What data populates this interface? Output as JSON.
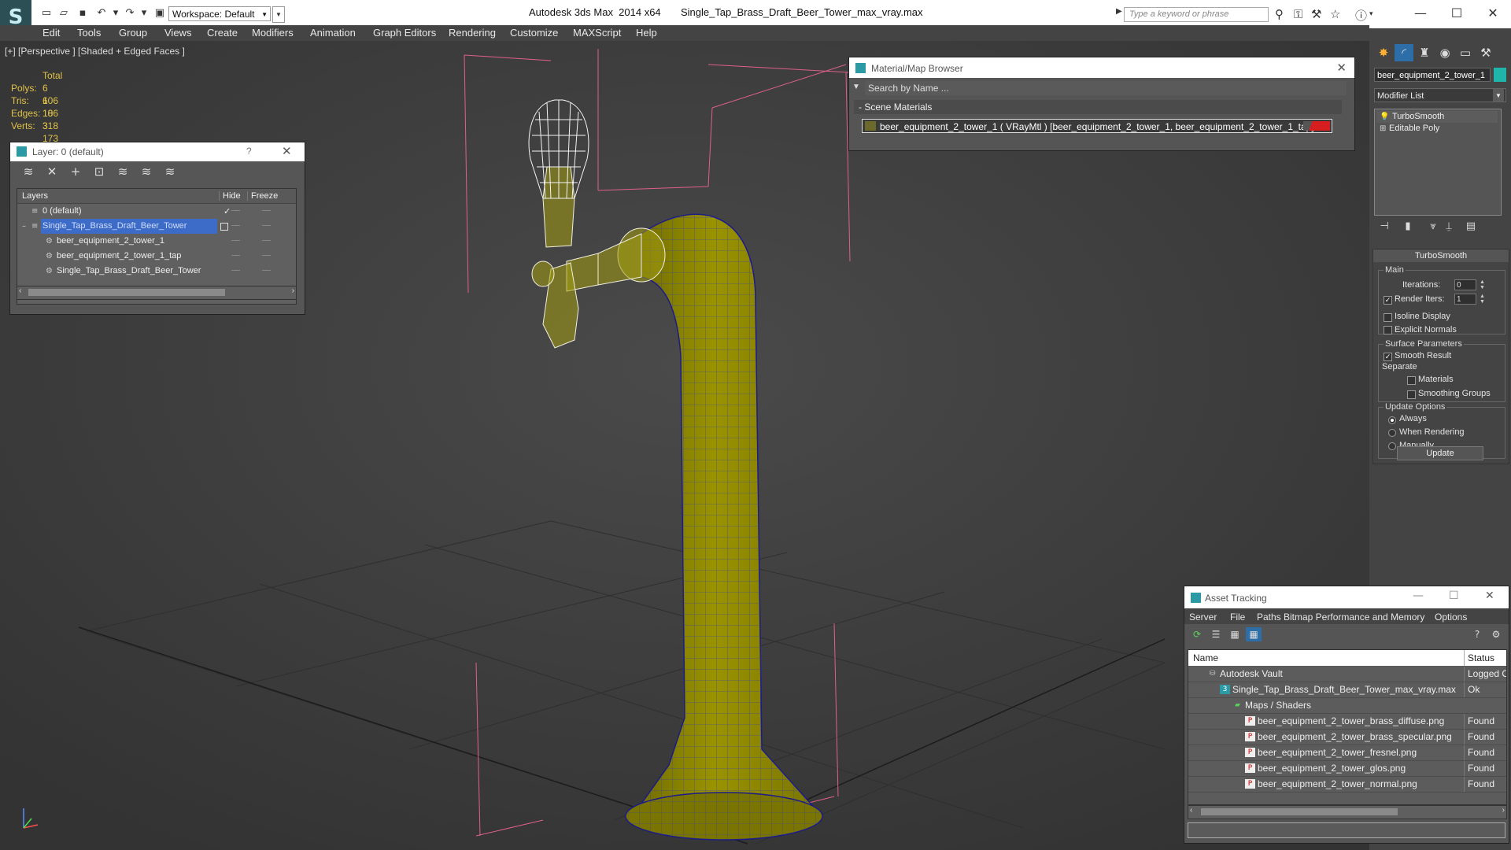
{
  "titlebar": {
    "workspace": "Workspace: Default",
    "app_title": "Autodesk 3ds Max  2014 x64       Single_Tap_Brass_Draft_Beer_Tower_max_vray.max",
    "search_placeholder": "Type a keyword or phrase"
  },
  "menu": [
    "Edit",
    "Tools",
    "Group",
    "Views",
    "Create",
    "Modifiers",
    "Animation",
    "Graph Editors",
    "Rendering",
    "Customize",
    "MAXScript",
    "Help"
  ],
  "viewport": {
    "label": "[+] [Perspective ] [Shaded + Edged Faces ]",
    "stats_header": "Total",
    "stats": [
      {
        "label": "Polys:",
        "value": "6 106"
      },
      {
        "label": "Tris:",
        "value": "6 106"
      },
      {
        "label": "Edges:",
        "value": "18 318"
      },
      {
        "label": "Verts:",
        "value": "3 173"
      }
    ],
    "model_color": "#8b8400",
    "wire_color": "#ffffff"
  },
  "layer_window": {
    "title": "Layer: 0 (default)",
    "help": "?",
    "col_layers": "Layers",
    "col_hide": "Hide",
    "col_freeze": "Freeze",
    "rows": [
      {
        "name": "0 (default)"
      },
      {
        "name": "Single_Tap_Brass_Draft_Beer_Tower"
      },
      {
        "name": "beer_equipment_2_tower_1"
      },
      {
        "name": "beer_equipment_2_tower_1_tap"
      },
      {
        "name": "Single_Tap_Brass_Draft_Beer_Tower"
      }
    ]
  },
  "material_browser": {
    "title": "Material/Map Browser",
    "search_placeholder": "Search by Name ...",
    "section": "- Scene Materials",
    "item": "beer_equipment_2_tower_1  ( VRayMtl )  [beer_equipment_2_tower_1, beer_equipment_2_tower_1_tap]"
  },
  "command_panel": {
    "object_name": "beer_equipment_2_tower_1",
    "modifier_list": "Modifier List",
    "stack": [
      "TurboSmooth",
      "Editable Poly"
    ],
    "rollout": "TurboSmooth",
    "group_main": "Main",
    "iterations_label": "Iterations:",
    "iterations": "0",
    "render_iters_label": "Render Iters:",
    "render_iters": "1",
    "isoline": "Isoline Display",
    "explicit_normals": "Explicit Normals",
    "group_surface": "Surface Parameters",
    "smooth_result": "Smooth Result",
    "separate": "Separate",
    "materials": "Materials",
    "smoothing_groups": "Smoothing Groups",
    "group_update": "Update Options",
    "always": "Always",
    "when_rendering": "When Rendering",
    "manually": "Manually",
    "update_button": "Update"
  },
  "asset_tracking": {
    "title": "Asset Tracking",
    "menu": [
      "Server",
      "File",
      "Paths",
      "Bitmap Performance and Memory",
      "Options"
    ],
    "col_name": "Name",
    "col_status": "Status",
    "rows": [
      {
        "name": "Autodesk Vault",
        "status": "Logged O"
      },
      {
        "name": "Single_Tap_Brass_Draft_Beer_Tower_max_vray.max",
        "status": "Ok"
      },
      {
        "name": "Maps / Shaders",
        "status": ""
      },
      {
        "name": "beer_equipment_2_tower_brass_diffuse.png",
        "status": "Found"
      },
      {
        "name": "beer_equipment_2_tower_brass_specular.png",
        "status": "Found"
      },
      {
        "name": "beer_equipment_2_tower_fresnel.png",
        "status": "Found"
      },
      {
        "name": "beer_equipment_2_tower_glos.png",
        "status": "Found"
      },
      {
        "name": "beer_equipment_2_tower_normal.png",
        "status": "Found"
      }
    ]
  }
}
